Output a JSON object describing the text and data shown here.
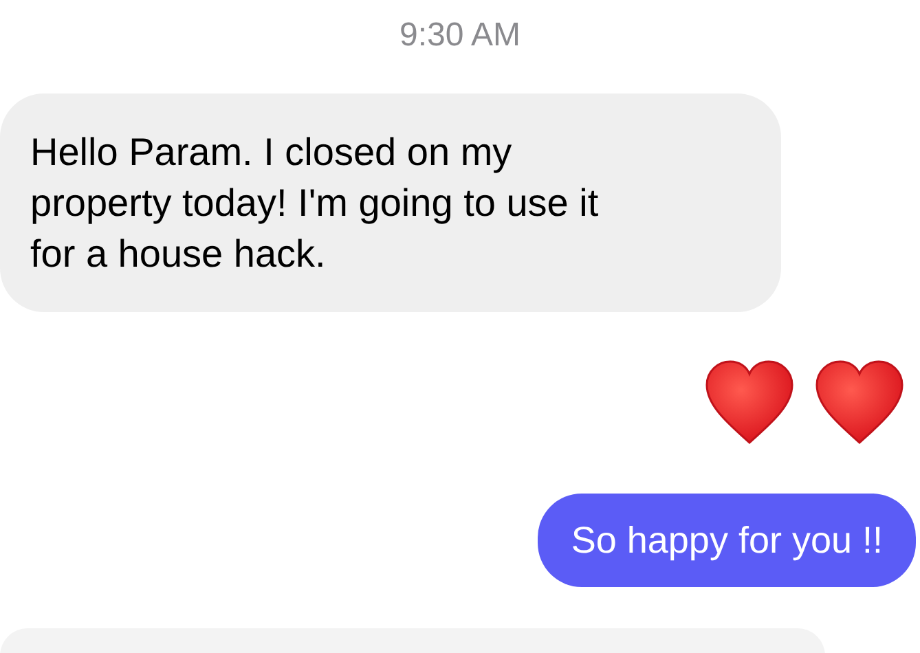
{
  "timestamp": "9:30 AM",
  "messages": [
    {
      "kind": "text",
      "outgoing": false,
      "text": "Hello Param. I closed on my\nproperty today! I'm going to use it\nfor a house hack."
    },
    {
      "kind": "emoji",
      "outgoing": true,
      "emoji": [
        {
          "kind": "heart"
        },
        {
          "kind": "heart"
        }
      ]
    },
    {
      "kind": "text",
      "outgoing": true,
      "text": "So happy for you !!"
    },
    {
      "kind": "cut_off",
      "outgoing": false
    }
  ]
}
